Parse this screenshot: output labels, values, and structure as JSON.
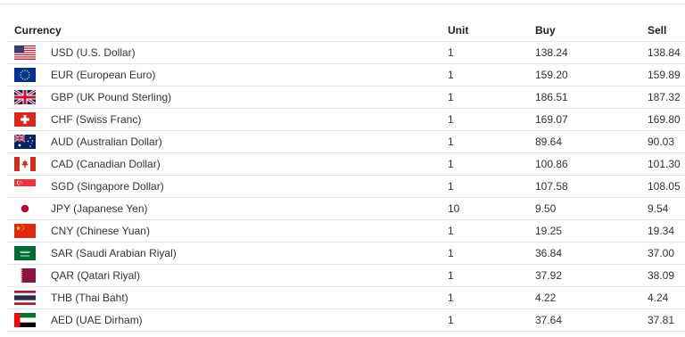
{
  "table": {
    "headers": {
      "currency": "Currency",
      "unit": "Unit",
      "buy": "Buy",
      "sell": "Sell"
    },
    "rows": [
      {
        "flag": "us-flag-icon",
        "currency": "USD (U.S. Dollar)",
        "unit": "1",
        "buy": "138.24",
        "sell": "138.84"
      },
      {
        "flag": "eu-flag-icon",
        "currency": "EUR (European Euro)",
        "unit": "1",
        "buy": "159.20",
        "sell": "159.89"
      },
      {
        "flag": "uk-flag-icon",
        "currency": "GBP (UK Pound Sterling)",
        "unit": "1",
        "buy": "186.51",
        "sell": "187.32"
      },
      {
        "flag": "ch-flag-icon",
        "currency": "CHF (Swiss Franc)",
        "unit": "1",
        "buy": "169.07",
        "sell": "169.80"
      },
      {
        "flag": "au-flag-icon",
        "currency": "AUD (Australian Dollar)",
        "unit": "1",
        "buy": "89.64",
        "sell": "90.03"
      },
      {
        "flag": "ca-flag-icon",
        "currency": "CAD (Canadian Dollar)",
        "unit": "1",
        "buy": "100.86",
        "sell": "101.30"
      },
      {
        "flag": "sg-flag-icon",
        "currency": "SGD (Singapore Dollar)",
        "unit": "1",
        "buy": "107.58",
        "sell": "108.05"
      },
      {
        "flag": "jp-flag-icon",
        "currency": "JPY (Japanese Yen)",
        "unit": "10",
        "buy": "9.50",
        "sell": "9.54"
      },
      {
        "flag": "cn-flag-icon",
        "currency": "CNY (Chinese Yuan)",
        "unit": "1",
        "buy": "19.25",
        "sell": "19.34"
      },
      {
        "flag": "sa-flag-icon",
        "currency": "SAR (Saudi Arabian Riyal)",
        "unit": "1",
        "buy": "36.84",
        "sell": "37.00"
      },
      {
        "flag": "qa-flag-icon",
        "currency": "QAR (Qatari Riyal)",
        "unit": "1",
        "buy": "37.92",
        "sell": "38.09"
      },
      {
        "flag": "th-flag-icon",
        "currency": "THB (Thai Baht)",
        "unit": "1",
        "buy": "4.22",
        "sell": "4.24"
      },
      {
        "flag": "ae-flag-icon",
        "currency": "AED (UAE Dirham)",
        "unit": "1",
        "buy": "37.64",
        "sell": "37.81"
      }
    ]
  }
}
